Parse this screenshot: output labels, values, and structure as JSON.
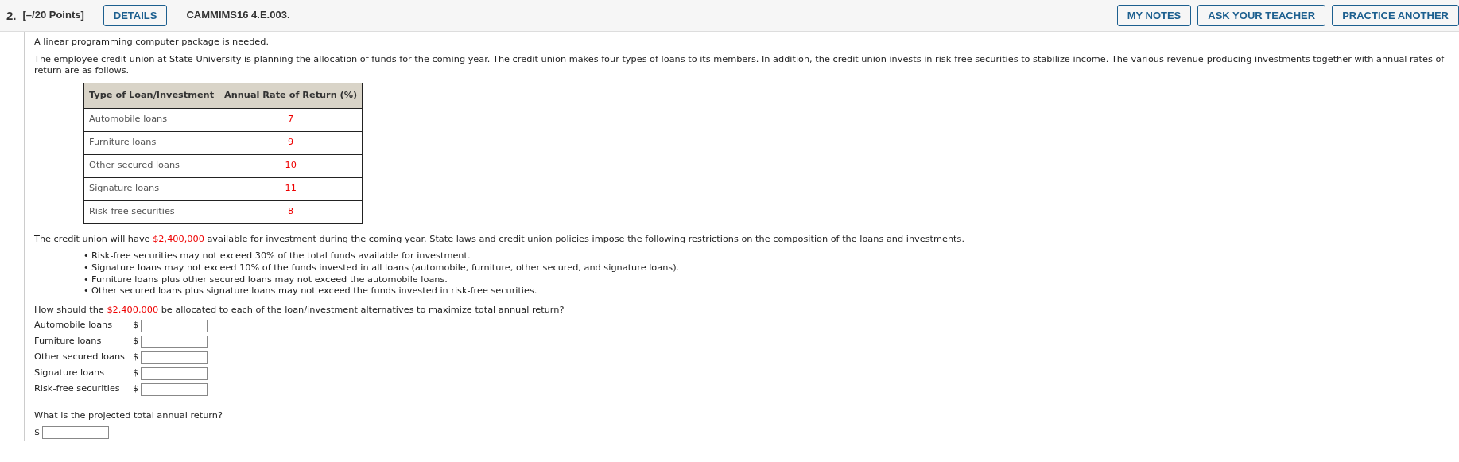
{
  "header": {
    "number": "2.",
    "points": "[–/20 Points]",
    "details_button": "DETAILS",
    "code": "CAMMIMS16 4.E.003.",
    "buttons": [
      "MY NOTES",
      "ASK YOUR TEACHER",
      "PRACTICE ANOTHER"
    ]
  },
  "intro": "A linear programming computer package is needed.",
  "description": "The employee credit union at State University is planning the allocation of funds for the coming year. The credit union makes four types of loans to its members. In addition, the credit union invests in risk-free securities to stabilize income. The various revenue-producing investments together with annual rates of return are as follows.",
  "table": {
    "columns": [
      "Type of Loan/Investment",
      "Annual Rate of Return (%)"
    ],
    "rows": [
      [
        "Automobile loans",
        "7"
      ],
      [
        "Furniture loans",
        "9"
      ],
      [
        "Other secured loans",
        "10"
      ],
      [
        "Signature loans",
        "11"
      ],
      [
        "Risk-free securities",
        "8"
      ]
    ]
  },
  "funds_sentence": {
    "before": "The credit union will have ",
    "amount": "$2,400,000",
    "after": " available for investment during the coming year. State laws and credit union policies impose the following restrictions on the composition of the loans and investments."
  },
  "restrictions": [
    {
      "marker": "•",
      "text": "Risk-free securities may not exceed 30% of the total funds available for investment."
    },
    {
      "marker": "•",
      "text": "Signature loans may not exceed 10% of the funds invested in all loans (automobile, furniture, other secured, and signature loans)."
    },
    {
      "marker": "•",
      "text": "Furniture loans plus other secured loans may not exceed the automobile loans."
    },
    {
      "marker": "•",
      "text": "Other secured loans plus signature loans may not exceed the funds invested in risk-free securities."
    }
  ],
  "question": {
    "before": "How should the ",
    "amount": "$2,400,000",
    "after": " be allocated to each of the loan/investment alternatives to maximize total annual return?"
  },
  "answers": [
    {
      "label": "Automobile loans",
      "currency": "$"
    },
    {
      "label": "Furniture loans",
      "currency": "$"
    },
    {
      "label": "Other secured loans",
      "currency": "$"
    },
    {
      "label": "Signature loans",
      "currency": "$"
    },
    {
      "label": "Risk-free securities",
      "currency": "$"
    }
  ],
  "total_question": "What is the projected total annual return?",
  "total_answer": {
    "currency": "$"
  }
}
